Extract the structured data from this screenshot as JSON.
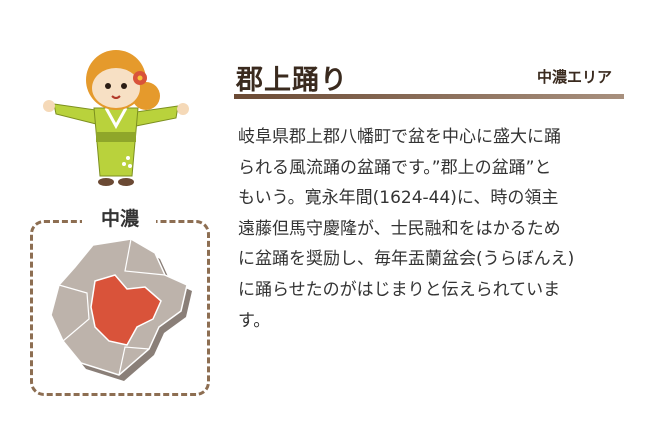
{
  "title": "郡上踊り",
  "area": "中濃エリア",
  "region": {
    "label": "中濃"
  },
  "description_lines": [
    "岐阜県郡上郡八幡町で盆を中心に盛大に踊",
    "られる風流踊の盆踊です。”郡上の盆踊”と",
    "もいう。寛永年間(1624‐44)に、時の領主",
    "遠藤但馬守慶隆が、士民融和をはかるため",
    "に盆踊を奨励し、毎年盂蘭盆会(うらぼんえ)",
    "に踊らせたのがはじまりと伝えられていま",
    "す。"
  ],
  "colors": {
    "title": "#3a2a1e",
    "rule_start": "#6b4a34",
    "rule_end": "#a8907e",
    "map_border": "#8d6e52",
    "map_land": "#bdb3ab",
    "map_highlight": "#d9533a",
    "kimono": "#b9d23c",
    "hair": "#e59a2c"
  },
  "icons": [
    "mascot-girl-icon",
    "gifu-map-icon"
  ]
}
